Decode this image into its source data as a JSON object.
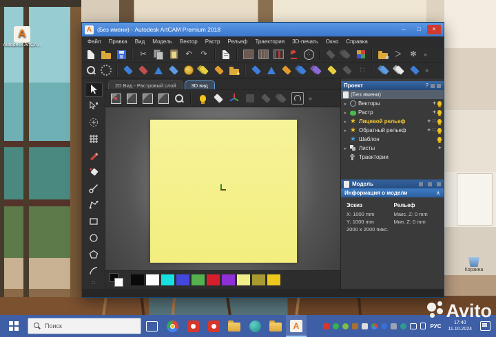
{
  "glyphs": {
    "minimize": "–",
    "maximize": "□",
    "close": "×",
    "cut": "✂",
    "undo": "↶",
    "redo": "↷",
    "overflow": "»",
    "expander": "▸",
    "plus": "+",
    "dots": "∷",
    "collapse": "∧",
    "help": "?",
    "dots3": "∴",
    "chevron": "＞",
    "spark": "✻",
    "star": "★"
  },
  "window": {
    "title": "(Без имени) - Autodesk ArtCAM Premium 2018",
    "menu": [
      "Файл",
      "Правка",
      "Вид",
      "Модель",
      "Вектор",
      "Растр",
      "Рельеф",
      "Траектория",
      "3D-печать",
      "Окно",
      "Справка"
    ],
    "tabs": [
      {
        "label": "2D Вид - Растровый слой"
      },
      {
        "label": "3D вид"
      }
    ]
  },
  "project": {
    "title": "Проект",
    "root_label": "(Без имени)",
    "items": [
      {
        "label": "Векторы"
      },
      {
        "label": "Растр"
      },
      {
        "label": "Лицевой рельеф"
      },
      {
        "label": "Обратный рельеф"
      },
      {
        "label": "Шаблон"
      },
      {
        "label": "Листы"
      },
      {
        "label": "Траектории"
      }
    ]
  },
  "model_panel": {
    "title": "Модель"
  },
  "model_info": {
    "title": "Информация о модели",
    "sketch": {
      "title": "Эскиз",
      "x": "X: 1000 mm",
      "y": "Y: 1000 mm",
      "px": "2000 x 2000 пикс."
    },
    "relief": {
      "title": "Рельеф",
      "max": "Макс. Z: 0 mm",
      "min": "Мин. Z: 0 mm"
    }
  },
  "palette": [
    "#0a0a0a",
    "#ffffff",
    "#17e0e0",
    "#4348dd",
    "#54b14e",
    "#d61f2e",
    "#8f2fd6",
    "#f2ee8a",
    "#a89a2e",
    "#eec81c"
  ],
  "desktop": {
    "artcam_shortcut_label": "Autodesk ArtCA...",
    "recycle_label": "Корзина"
  },
  "taskbar": {
    "search_placeholder": "Поиск",
    "language": "РУС",
    "time": "17:40",
    "date": "11.10.2024"
  },
  "watermark": {
    "text": "Avito"
  }
}
